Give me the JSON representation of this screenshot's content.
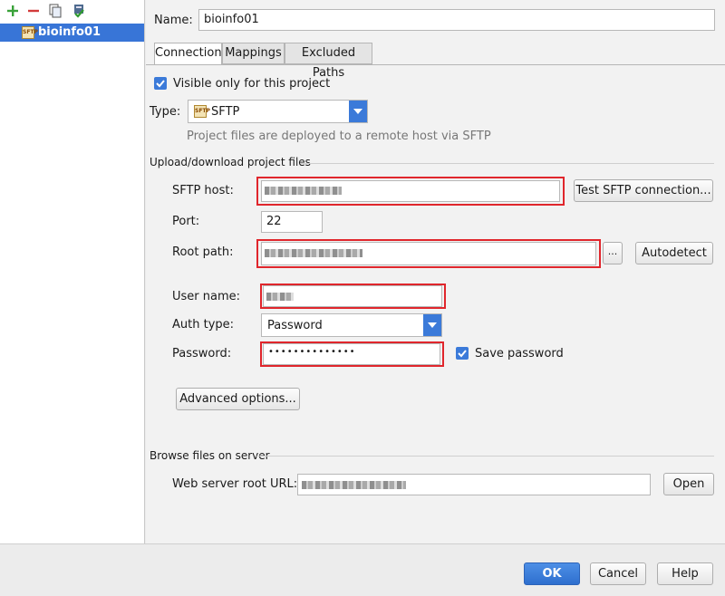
{
  "toolbar": {
    "add": "add-icon",
    "remove": "remove-icon",
    "copy": "copy-icon",
    "default": "set-default-icon"
  },
  "servers": [
    {
      "name": "bioinfo01",
      "icon_text": "SFTP"
    }
  ],
  "name_label": "Name:",
  "name_value": "bioinfo01",
  "tabs": [
    "Connection",
    "Mappings",
    "Excluded Paths"
  ],
  "visible_only": {
    "label": "Visible only for this project",
    "checked": true
  },
  "type": {
    "label": "Type:",
    "value": "SFTP",
    "icon_text": "SFTP",
    "description": "Project files are deployed to a remote host via SFTP"
  },
  "upload_section": "Upload/download project files",
  "sftp_host": {
    "label": "SFTP host:",
    "value": ""
  },
  "test_button": "Test SFTP connection...",
  "port": {
    "label": "Port:",
    "value": "22"
  },
  "root_path": {
    "label": "Root path:",
    "value": ""
  },
  "browse_button": "...",
  "autodetect_button": "Autodetect",
  "user_name": {
    "label": "User name:",
    "value": ""
  },
  "auth_type": {
    "label": "Auth type:",
    "value": "Password"
  },
  "password": {
    "label": "Password:",
    "value": "••••••••••••••"
  },
  "save_password": {
    "label": "Save password",
    "checked": true
  },
  "advanced_button": "Advanced options...",
  "browse_section": "Browse files on server",
  "web_root": {
    "label": "Web server root URL:",
    "value": ""
  },
  "open_button": "Open",
  "footer": {
    "ok": "OK",
    "cancel": "Cancel",
    "help": "Help"
  },
  "colors": {
    "accent": "#3875d7",
    "highlight": "#e0262c"
  }
}
